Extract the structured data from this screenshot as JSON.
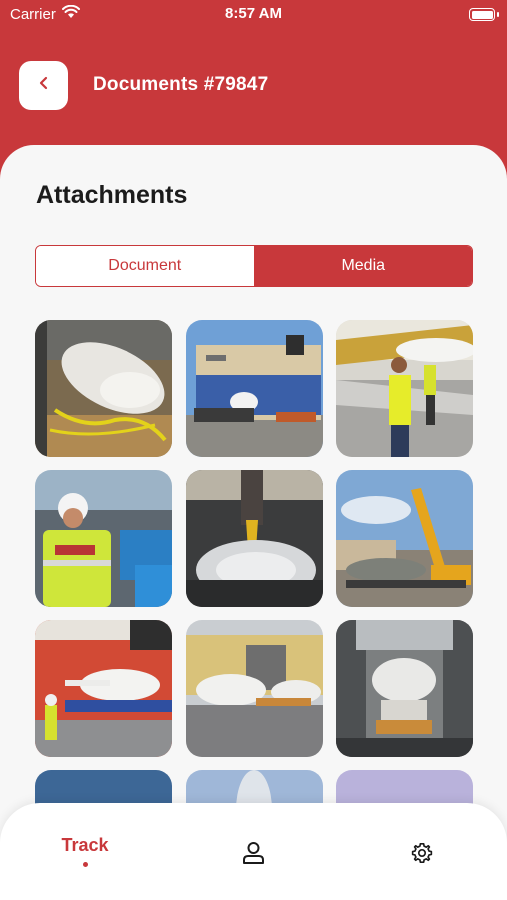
{
  "status_bar": {
    "carrier": "Carrier",
    "time": "8:57 AM"
  },
  "header": {
    "title": "Documents #79847",
    "back_icon": "chevron-left-icon"
  },
  "attachments": {
    "title": "Attachments",
    "tabs": [
      {
        "label": "Document",
        "selected": false
      },
      {
        "label": "Media",
        "selected": true
      }
    ]
  },
  "tab_bar": {
    "items": [
      {
        "label": "Track",
        "icon": "track",
        "active": true
      },
      {
        "label": "",
        "icon": "person-icon",
        "active": false
      },
      {
        "label": "",
        "icon": "gear-icon",
        "active": false
      }
    ]
  },
  "colors": {
    "brand": "#c8383b",
    "background": "#f7f7f7",
    "surface": "#ffffff",
    "text": "#1b1b1b"
  }
}
